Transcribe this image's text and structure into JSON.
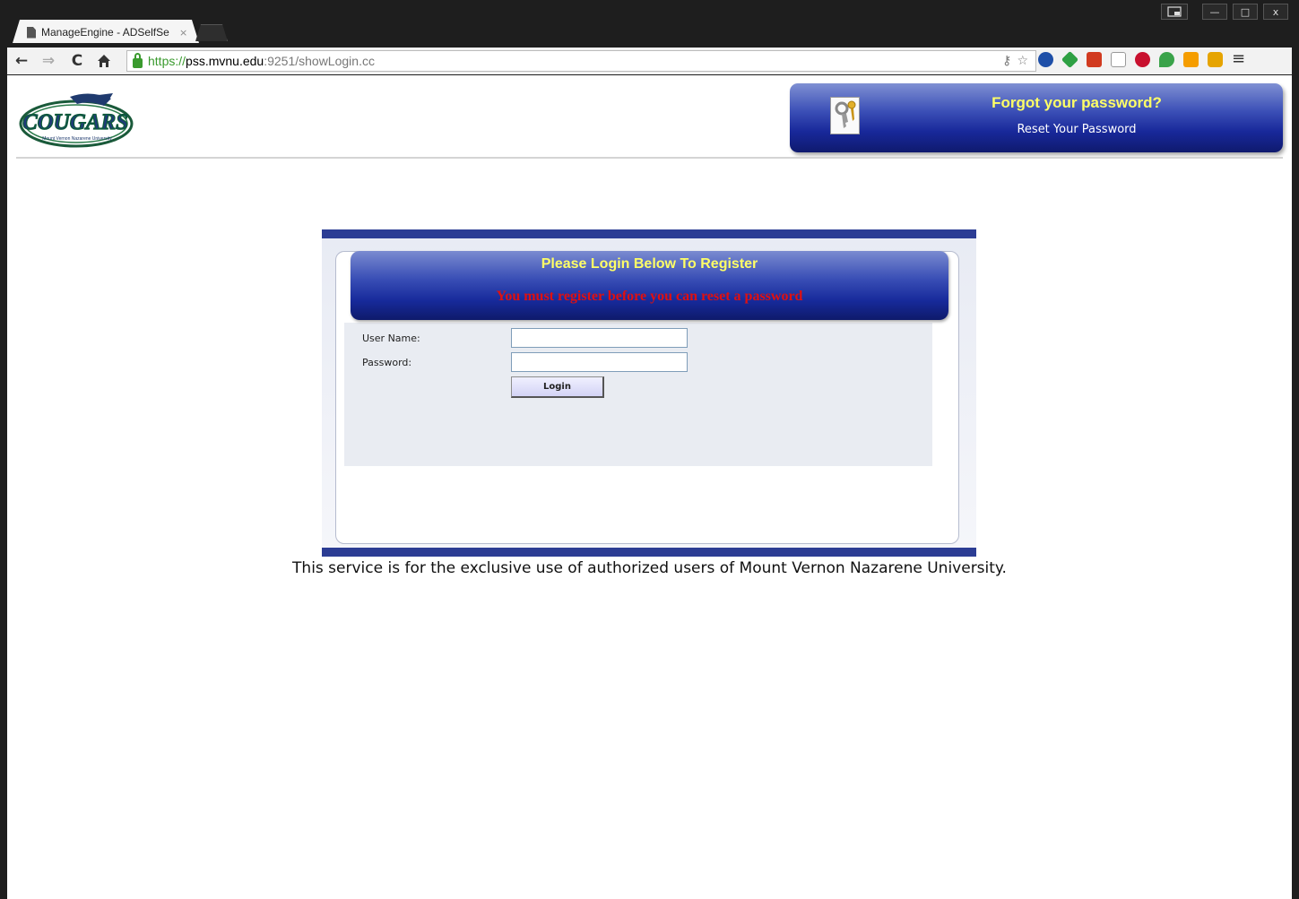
{
  "browser": {
    "tab_title": "ManageEngine - ADSelfSe",
    "tab_close": "×",
    "window_buttons": {
      "minimize": "—",
      "maximize": "□",
      "close": "x"
    },
    "url_scheme": "https://",
    "url_host": "pss.mvnu.edu",
    "url_rest": ":9251/showLogin.cc"
  },
  "header": {
    "logo_text": "COUGARS",
    "logo_subtext": "Mount Vernon Nazarene University",
    "forgot_title": "Forgot your password?",
    "forgot_link": "Reset Your Password"
  },
  "login": {
    "title": "Please Login Below To Register",
    "warning": "You must register before you can reset a password",
    "username_label": "User Name:",
    "password_label": "Password:",
    "username_value": "",
    "password_value": "",
    "login_button": "Login"
  },
  "footer": {
    "notice": "This service is for the exclusive use of authorized users of Mount Vernon Nazarene University."
  },
  "colors": {
    "panel_blue": "#2c3d94",
    "title_yellow": "#ffff66",
    "warning_red": "#e01010",
    "secure_green": "#3a9a2e"
  }
}
